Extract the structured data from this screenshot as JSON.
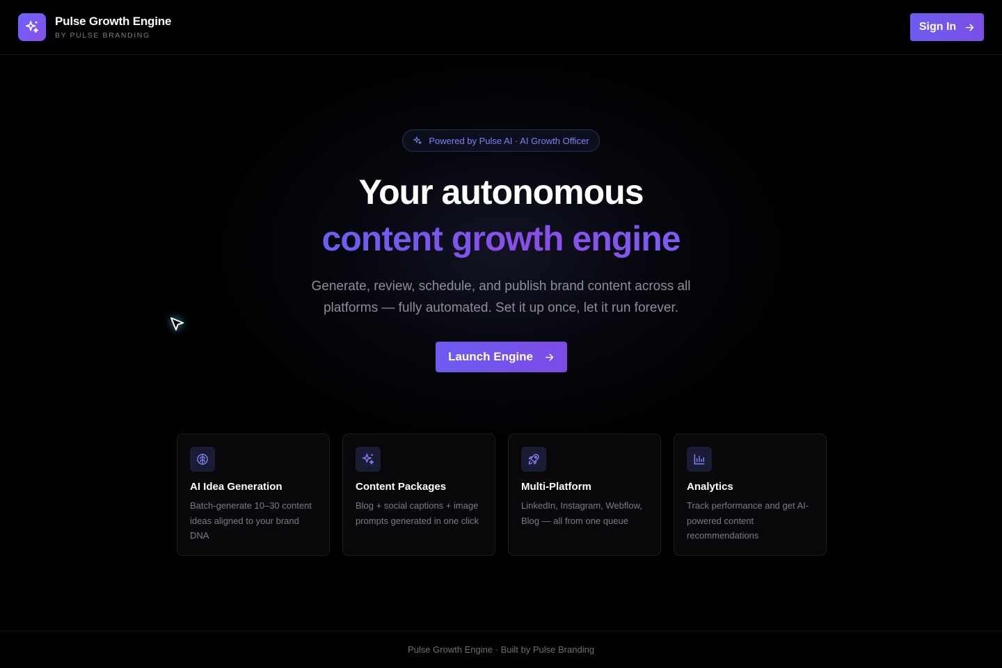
{
  "header": {
    "brand_title": "Pulse Growth Engine",
    "brand_subtitle": "BY PULSE BRANDING",
    "sign_in_label": "Sign In"
  },
  "hero": {
    "badge": "Powered by Pulse AI · AI Growth Officer",
    "headline_line1": "Your autonomous",
    "headline_line2": "content growth engine",
    "subtitle": "Generate, review, schedule, and publish brand content across all platforms — fully automated. Set it up once, let it run forever.",
    "cta_label": "Launch Engine"
  },
  "features": [
    {
      "icon": "brain-icon",
      "title": "AI Idea Generation",
      "description": "Batch-generate 10–30 content ideas aligned to your brand DNA"
    },
    {
      "icon": "sparkles-icon",
      "title": "Content Packages",
      "description": "Blog + social captions + image prompts generated in one click"
    },
    {
      "icon": "rocket-icon",
      "title": "Multi-Platform",
      "description": "LinkedIn, Instagram, Webflow, Blog — all from one queue"
    },
    {
      "icon": "bar-chart-icon",
      "title": "Analytics",
      "description": "Track performance and get AI-powered content recommendations"
    }
  ],
  "footer": {
    "text": "Pulse Growth Engine · Built by Pulse Branding"
  },
  "colors": {
    "background": "#000000",
    "accent": "#6d5cf0",
    "accent_secondary": "#8a4ee8",
    "icon_tint": "#7d82ee"
  }
}
